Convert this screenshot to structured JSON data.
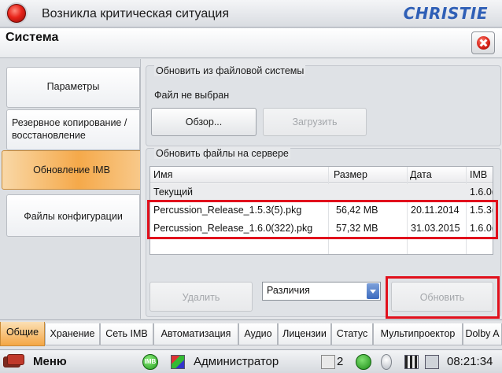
{
  "alert": {
    "text": "Возникла критическая ситуация"
  },
  "brand": {
    "logo_text": "CHRISTIE"
  },
  "page": {
    "title": "Система"
  },
  "sidebar": {
    "tabs": [
      {
        "label": "Параметры"
      },
      {
        "label_line1": "Резервное копирование /",
        "label_line2": "восстановление"
      },
      {
        "label": "Обновление IMB"
      },
      {
        "label": "Файлы конфигурации"
      }
    ]
  },
  "fs_update": {
    "title": "Обновить из файловой системы",
    "status": "Файл не выбран",
    "browse_label": "Обзор...",
    "upload_label": "Загрузить"
  },
  "server_update": {
    "title": "Обновить файлы на сервере",
    "columns": [
      "Имя",
      "Размер",
      "Дата",
      "IMB"
    ],
    "rows": [
      {
        "name": "Текущий",
        "size": "",
        "date": "",
        "imb": "1.6.0("
      },
      {
        "name": "Percussion_Release_1.5.3(5).pkg",
        "size": "56,42 MB",
        "date": "20.11.2014",
        "imb": "1.5.3("
      },
      {
        "name": "Percussion_Release_1.6.0(322).pkg",
        "size": "57,32 MB",
        "date": "31.03.2015",
        "imb": "1.6.0("
      }
    ],
    "delete_label": "Удалить",
    "filter_value": "Различия",
    "update_label": "Обновить"
  },
  "bottom_tabs": [
    "Общие",
    "Хранение",
    "Сеть IMB",
    "Автоматизация",
    "Аудио",
    "Лицензии",
    "Статус",
    "Мультипроектор",
    "Dolby A"
  ],
  "taskbar": {
    "menu_label": "Меню",
    "imb_badge": "IMB",
    "user": "Администратор",
    "sessions": "2",
    "time": "08:21:34"
  },
  "colors": {
    "accent_orange": "#f5a94a",
    "highlight_red": "#e1101c",
    "brand_blue": "#2f5fb6"
  }
}
